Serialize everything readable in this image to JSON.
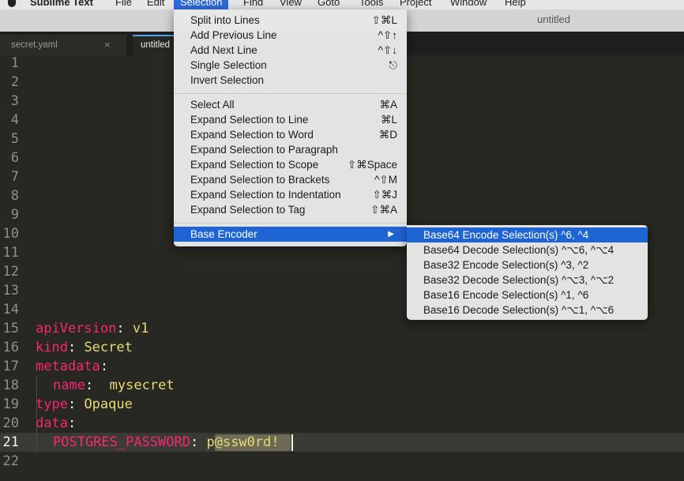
{
  "menubar": {
    "app_name": "Sublime Text",
    "items": [
      "File",
      "Edit",
      "Selection",
      "Find",
      "View",
      "Goto",
      "Tools",
      "Project",
      "Window",
      "Help"
    ]
  },
  "window": {
    "title": "untitled"
  },
  "tabs": [
    {
      "label": "secret.yaml",
      "close": "×"
    },
    {
      "label": "untitled"
    }
  ],
  "editor": {
    "line_numbers": [
      "1",
      "2",
      "3",
      "4",
      "5",
      "6",
      "7",
      "8",
      "9",
      "10",
      "11",
      "12",
      "13",
      "14",
      "15",
      "16",
      "17",
      "18",
      "19",
      "20",
      "21",
      "22"
    ],
    "code": {
      "l15_key": "apiVersion",
      "l15_sep": ": ",
      "l15_val": "v1",
      "l16_key": "kind",
      "l16_sep": ": ",
      "l16_val": "Secret",
      "l17_key": "metadata",
      "l17_sep": ":",
      "l18_key": "name",
      "l18_sep": ":  ",
      "l18_val": "mysecret",
      "l19_key": "type",
      "l19_sep": ": ",
      "l19_val": "Opaque",
      "l20_key": "data",
      "l20_sep": ":",
      "l21_key": "POSTGRES_PASSWORD",
      "l21_sep": ": ",
      "l21_val": "p@ssw0rd!"
    }
  },
  "selection_menu": {
    "items": [
      {
        "label": "Split into Lines",
        "shortcut": "⇧⌘L"
      },
      {
        "label": "Add Previous Line",
        "shortcut": "^⇧↑"
      },
      {
        "label": "Add Next Line",
        "shortcut": "^⇧↓"
      },
      {
        "label": "Single Selection",
        "shortcut": "⎋"
      },
      {
        "label": "Invert Selection",
        "shortcut": ""
      },
      {
        "label": "Select All",
        "shortcut": "⌘A"
      },
      {
        "label": "Expand Selection to Line",
        "shortcut": "⌘L"
      },
      {
        "label": "Expand Selection to Word",
        "shortcut": "⌘D"
      },
      {
        "label": "Expand Selection to Paragraph",
        "shortcut": ""
      },
      {
        "label": "Expand Selection to Scope",
        "shortcut": "⇧⌘Space"
      },
      {
        "label": "Expand Selection to Brackets",
        "shortcut": "^⇧M"
      },
      {
        "label": "Expand Selection to Indentation",
        "shortcut": "⇧⌘J"
      },
      {
        "label": "Expand Selection to Tag",
        "shortcut": "⇧⌘A"
      },
      {
        "label": "Base Encoder",
        "shortcut": "▶"
      }
    ]
  },
  "base_encoder_menu": {
    "items": [
      {
        "label": "Base64 Encode Selection(s) ^6, ^4"
      },
      {
        "label": "Base64 Decode Selection(s) ^⌥6, ^⌥4"
      },
      {
        "label": "Base32 Encode Selection(s) ^3, ^2"
      },
      {
        "label": "Base32 Decode Selection(s) ^⌥3, ^⌥2"
      },
      {
        "label": "Base16 Encode Selection(s) ^1, ^6"
      },
      {
        "label": "Base16 Decode Selection(s) ^⌥1, ^⌥6"
      }
    ]
  },
  "colors": {
    "editor_bg": "#272822",
    "key": "#f92672",
    "value": "#e6db74",
    "highlight": "#1f64d3"
  }
}
